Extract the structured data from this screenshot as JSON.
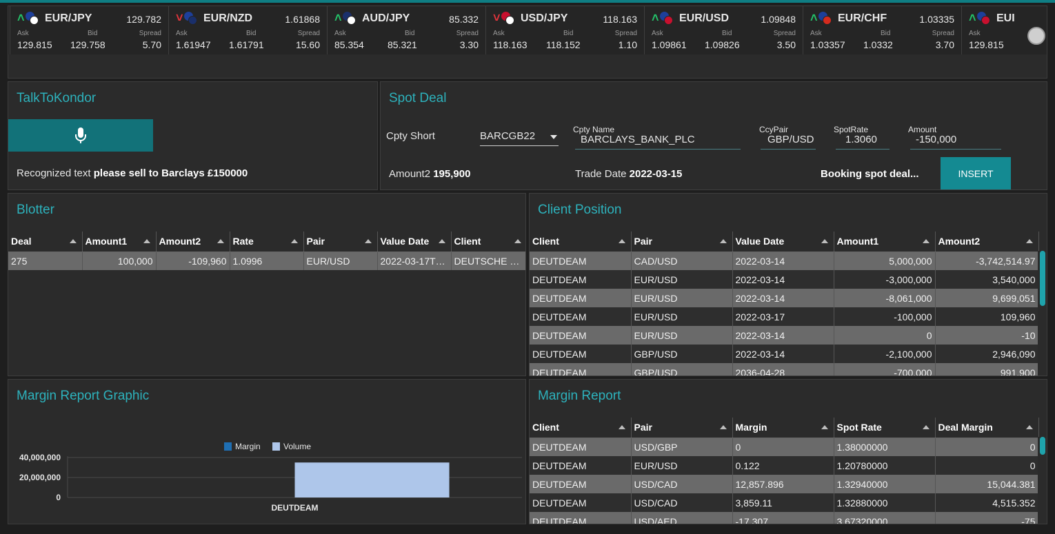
{
  "colors": {
    "accent": "#2db2bc",
    "up": "#24c36a",
    "down": "#e0343c",
    "button": "#127279",
    "margin_color": "#1f6fb3",
    "volume_color": "#aec6ea"
  },
  "ticker": [
    {
      "pair": "",
      "price": "",
      "dir": "",
      "ask": "",
      "bid": "",
      "spread": "3.70",
      "partial_price": ")3335",
      "partial_spread_label": "Spread"
    },
    {
      "pair": "EUR/JPY",
      "price": "129.782",
      "dir": "up",
      "ask": "129.815",
      "bid": "129.758",
      "spread": "5.70"
    },
    {
      "pair": "EUR/NZD",
      "price": "1.61868",
      "dir": "down",
      "ask": "1.61947",
      "bid": "1.61791",
      "spread": "15.60"
    },
    {
      "pair": "AUD/JPY",
      "price": "85.332",
      "dir": "up",
      "ask": "85.354",
      "bid": "85.321",
      "spread": "3.30"
    },
    {
      "pair": "USD/JPY",
      "price": "118.163",
      "dir": "down",
      "ask": "118.163",
      "bid": "118.152",
      "spread": "1.10"
    },
    {
      "pair": "EUR/USD",
      "price": "1.09848",
      "dir": "up",
      "ask": "1.09861",
      "bid": "1.09826",
      "spread": "3.50"
    },
    {
      "pair": "EUR/CHF",
      "price": "1.03335",
      "dir": "up",
      "ask": "1.03357",
      "bid": "1.0332",
      "spread": "3.70"
    },
    {
      "pair": "EUI",
      "price": "",
      "dir": "up",
      "ask": "129.815",
      "bid": "",
      "spread": ""
    }
  ],
  "ticker_labels": {
    "ask": "Ask",
    "bid": "Bid",
    "spread": "Spread"
  },
  "talk": {
    "title": "TalkToKondor",
    "recognized_label": "Recognized text",
    "recognized_text": "please sell to Barclays £150000"
  },
  "spot": {
    "title": "Spot Deal",
    "cpty_short_label": "Cpty Short",
    "cpty_short_value": "BARCGB22",
    "cpty_name_label": "Cpty Name",
    "cpty_name_value": "BARCLAYS_BANK_PLC",
    "ccypair_label": "CcyPair",
    "ccypair_value": "GBP/USD",
    "spotrate_label": "SpotRate",
    "spotrate_value": "1.3060",
    "amount_label": "Amount",
    "amount_value": "-150,000",
    "amount2_label": "Amount2",
    "amount2_value": "195,900",
    "trade_date_label": "Trade Date",
    "trade_date_value": "2022-03-15",
    "status": "Booking spot deal...",
    "insert_label": "INSERT"
  },
  "blotter": {
    "title": "Blotter",
    "columns": [
      "Deal",
      "Amount1",
      "Amount2",
      "Rate",
      "Pair",
      "Value Date",
      "Client"
    ],
    "rows": [
      [
        "275",
        "100,000",
        "-109,960",
        "1.0996",
        "EUR/USD",
        "2022-03-17T0...",
        "DEUTSCHE BA..."
      ]
    ]
  },
  "client_position": {
    "title": "Client Position",
    "columns": [
      "Client",
      "Pair",
      "Value Date",
      "Amount1",
      "Amount2"
    ],
    "rows": [
      [
        "DEUTDEAM",
        "CAD/USD",
        "2022-03-14",
        "5,000,000",
        "-3,742,514.97"
      ],
      [
        "DEUTDEAM",
        "EUR/USD",
        "2022-03-14",
        "-3,000,000",
        "3,540,000"
      ],
      [
        "DEUTDEAM",
        "EUR/USD",
        "2022-03-14",
        "-8,061,000",
        "9,699,051"
      ],
      [
        "DEUTDEAM",
        "EUR/USD",
        "2022-03-17",
        "-100,000",
        "109,960"
      ],
      [
        "DEUTDEAM",
        "EUR/USD",
        "2022-03-14",
        "0",
        "-10"
      ],
      [
        "DEUTDEAM",
        "GBP/USD",
        "2022-03-14",
        "-2,100,000",
        "2,946,090"
      ],
      [
        "DEUTDEAM",
        "GBP/USD",
        "2036-04-28",
        "-700,000",
        "991,900"
      ]
    ]
  },
  "margin_graphic": {
    "title": "Margin Report Graphic"
  },
  "chart_data": {
    "type": "bar",
    "categories": [
      "DEUTDEAM"
    ],
    "series": [
      {
        "name": "Margin",
        "values": [
          0
        ]
      },
      {
        "name": "Volume",
        "values": [
          35000000
        ]
      }
    ],
    "y_ticks": [
      "40,000,000",
      "20,000,000",
      "0"
    ],
    "ylim": [
      0,
      40000000
    ],
    "legend": "top-center",
    "grid": true
  },
  "margin_report": {
    "title": "Margin Report",
    "columns": [
      "Client",
      "Pair",
      "Margin",
      "Spot Rate",
      "Deal Margin"
    ],
    "rows": [
      [
        "DEUTDEAM",
        "USD/GBP",
        "0",
        "1.38000000",
        "0"
      ],
      [
        "DEUTDEAM",
        "EUR/USD",
        "0.122",
        "1.20780000",
        "0"
      ],
      [
        "DEUTDEAM",
        "USD/CAD",
        "12,857.896",
        "1.32940000",
        "15,044.381"
      ],
      [
        "DEUTDEAM",
        "USD/CAD",
        "3,859.11",
        "1.32880000",
        "4,515.352"
      ],
      [
        "DEUTDEAM",
        "USD/AED",
        "-17.307",
        "3.67320000",
        "-75"
      ]
    ]
  }
}
